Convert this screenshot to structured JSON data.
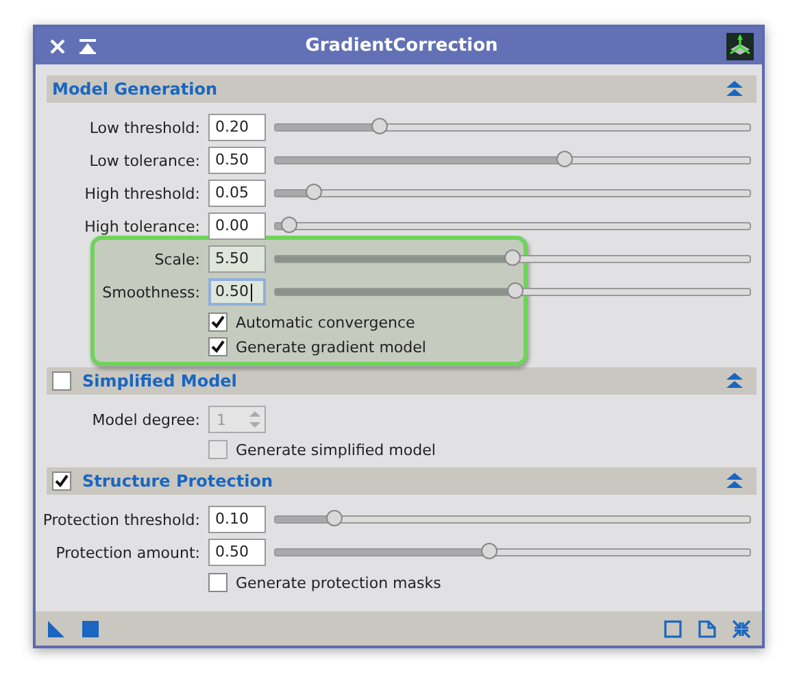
{
  "window": {
    "title": "GradientCorrection"
  },
  "sections": [
    {
      "title": "Model Generation",
      "items": [
        {
          "kind": "slider",
          "label": "Low threshold:",
          "value": "0.20",
          "level": 0.22
        },
        {
          "kind": "slider",
          "label": "Low tolerance:",
          "value": "0.50",
          "level": 0.61
        },
        {
          "kind": "slider",
          "label": "High threshold:",
          "value": "0.05",
          "level": 0.08
        },
        {
          "kind": "slider",
          "label": "High tolerance:",
          "value": "0.00",
          "level": 0.03
        },
        {
          "kind": "slider",
          "label": "Scale:",
          "value": "5.50",
          "level": 0.5,
          "highlighted": true
        },
        {
          "kind": "slider",
          "label": "Smoothness:",
          "value": "0.50",
          "level": 0.505,
          "highlighted": true,
          "focused": true
        },
        {
          "kind": "checkbox",
          "label": "Automatic convergence",
          "checked": true,
          "highlighted": true
        },
        {
          "kind": "checkbox",
          "label": "Generate gradient model",
          "checked": true,
          "highlighted": true
        }
      ]
    },
    {
      "title": "Simplified Model",
      "checked": false,
      "items": [
        {
          "kind": "spin",
          "label": "Model degree:",
          "value": "1",
          "disabled": true
        },
        {
          "kind": "checkbox",
          "label": "Generate simplified model",
          "checked": false,
          "disabled": true
        }
      ]
    },
    {
      "title": "Structure Protection",
      "checked": true,
      "items": [
        {
          "kind": "slider",
          "label": "Protection threshold:",
          "value": "0.10",
          "level": 0.125
        },
        {
          "kind": "slider",
          "label": "Protection amount:",
          "value": "0.50",
          "level": 0.45
        },
        {
          "kind": "checkbox",
          "label": "Generate protection masks",
          "checked": false
        }
      ]
    }
  ]
}
